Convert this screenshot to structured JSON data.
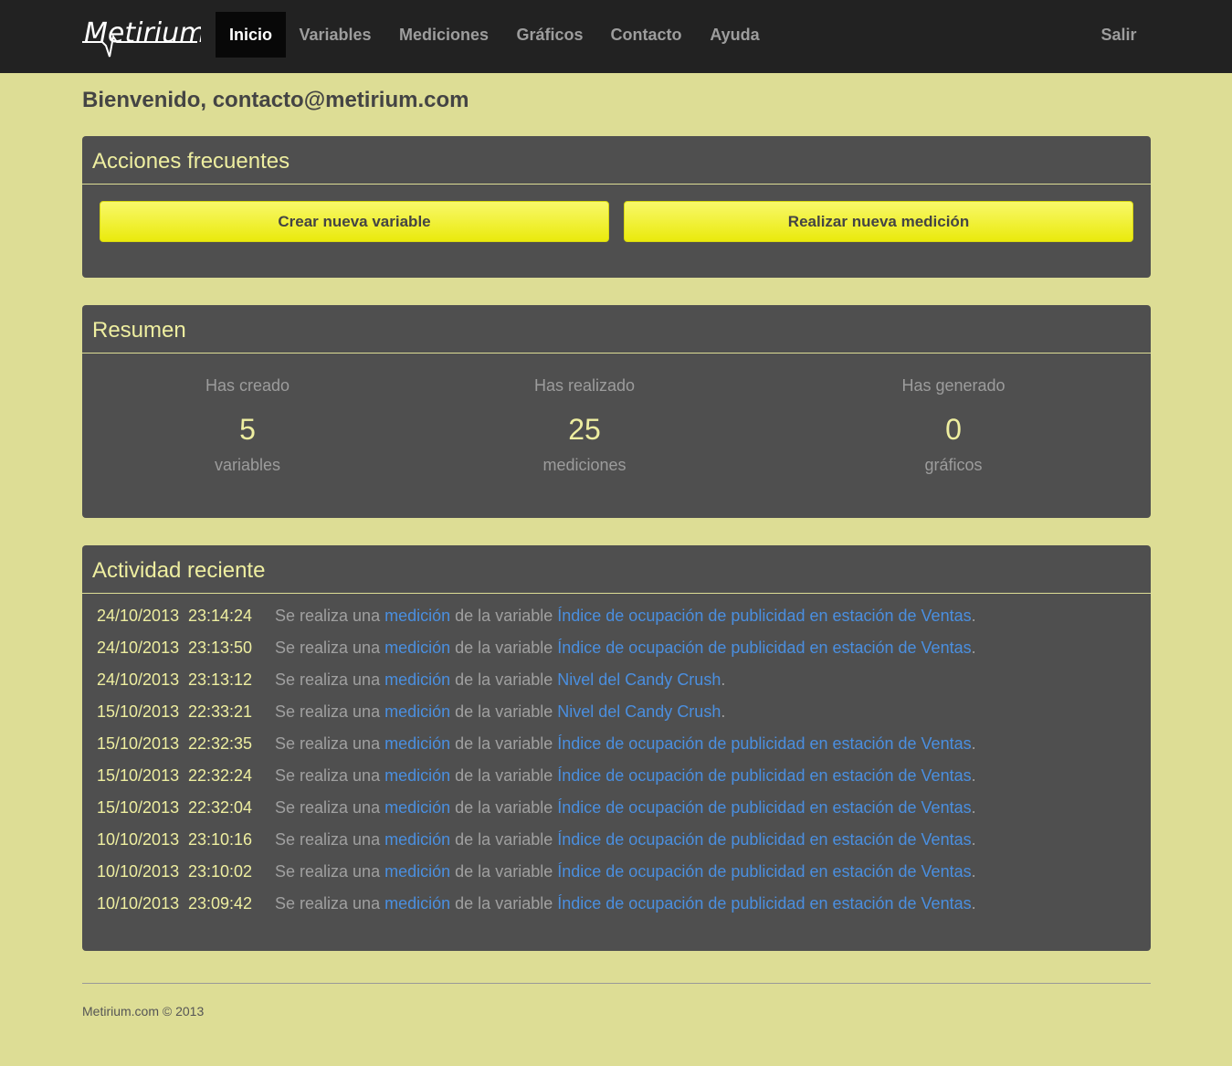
{
  "brand": {
    "name": "Metirium"
  },
  "nav": {
    "items": [
      {
        "label": "Inicio",
        "active": true
      },
      {
        "label": "Variables"
      },
      {
        "label": "Mediciones"
      },
      {
        "label": "Gráficos"
      },
      {
        "label": "Contacto"
      },
      {
        "label": "Ayuda"
      }
    ],
    "logout": "Salir"
  },
  "welcome": "Bienvenido, contacto@metirium.com",
  "actions": {
    "title": "Acciones frecuentes",
    "create_variable": "Crear nueva variable",
    "new_measurement": "Realizar nueva medición"
  },
  "summary": {
    "title": "Resumen",
    "stats": [
      {
        "top": "Has creado",
        "value": "5",
        "unit": "variables"
      },
      {
        "top": "Has realizado",
        "value": "25",
        "unit": "mediciones"
      },
      {
        "top": "Has generado",
        "value": "0",
        "unit": "gráficos"
      }
    ]
  },
  "activity": {
    "title": "Actividad reciente",
    "prefix": "Se realiza una",
    "link1": "medición",
    "middle": "de la variable",
    "suffix": ".",
    "rows": [
      {
        "date": "24/10/2013",
        "time": "23:14:24",
        "variable": "Índice de ocupación de publicidad en estación de Ventas"
      },
      {
        "date": "24/10/2013",
        "time": "23:13:50",
        "variable": "Índice de ocupación de publicidad en estación de Ventas"
      },
      {
        "date": "24/10/2013",
        "time": "23:13:12",
        "variable": "Nivel del Candy Crush"
      },
      {
        "date": "15/10/2013",
        "time": "22:33:21",
        "variable": "Nivel del Candy Crush"
      },
      {
        "date": "15/10/2013",
        "time": "22:32:35",
        "variable": "Índice de ocupación de publicidad en estación de Ventas"
      },
      {
        "date": "15/10/2013",
        "time": "22:32:24",
        "variable": "Índice de ocupación de publicidad en estación de Ventas"
      },
      {
        "date": "15/10/2013",
        "time": "22:32:04",
        "variable": "Índice de ocupación de publicidad en estación de Ventas"
      },
      {
        "date": "10/10/2013",
        "time": "23:10:16",
        "variable": "Índice de ocupación de publicidad en estación de Ventas"
      },
      {
        "date": "10/10/2013",
        "time": "23:10:02",
        "variable": "Índice de ocupación de publicidad en estación de Ventas"
      },
      {
        "date": "10/10/2013",
        "time": "23:09:42",
        "variable": "Índice de ocupación de publicidad en estación de Ventas"
      }
    ]
  },
  "footer": "Metirium.com © 2013",
  "colors": {
    "background": "#dddd95",
    "navbar": "#222222",
    "panel": "#4f4f4f",
    "accent_yellow": "#eeeea0",
    "button_yellow": "#f0f020",
    "link": "#4a8fe0"
  }
}
